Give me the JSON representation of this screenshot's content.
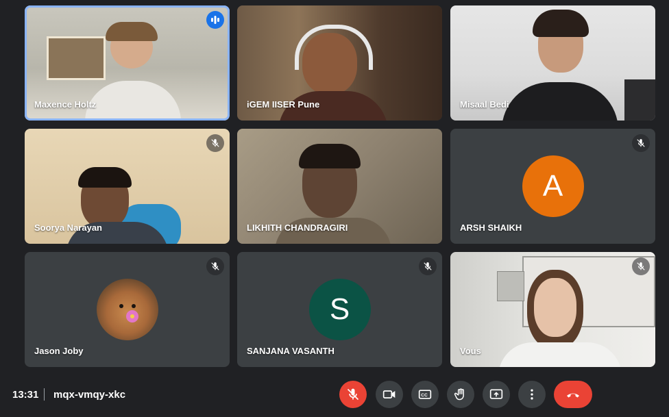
{
  "participants": [
    {
      "name": "Maxence Holtz",
      "state": "speaking"
    },
    {
      "name": "iGEM IISER Pune",
      "state": "video"
    },
    {
      "name": "Misaal Bedi",
      "state": "video"
    },
    {
      "name": "Soorya Narayan",
      "state": "muted"
    },
    {
      "name": "LIKHITH CHANDRAGIRI",
      "state": "video"
    },
    {
      "name": "ARSH SHAIKH",
      "state": "muted",
      "avatar_letter": "A",
      "avatar_color": "#e8710a"
    },
    {
      "name": "Jason Joby",
      "state": "muted",
      "avatar_image": "dog-with-flower"
    },
    {
      "name": "SANJANA VASANTH",
      "state": "muted",
      "avatar_letter": "S",
      "avatar_color": "#0b5345"
    },
    {
      "name": "Vous",
      "state": "muted"
    }
  ],
  "bottom_bar": {
    "time": "13:31",
    "meeting_code": "mqx-vmqy-xkc",
    "controls": [
      "mic-off-icon",
      "camera-icon",
      "captions-icon",
      "raise-hand-icon",
      "present-screen-icon",
      "more-options-icon",
      "end-call-icon"
    ]
  },
  "colors": {
    "background": "#202124",
    "tile": "#3c4043",
    "accent": "#8ab4f8",
    "danger": "#ea4335"
  }
}
